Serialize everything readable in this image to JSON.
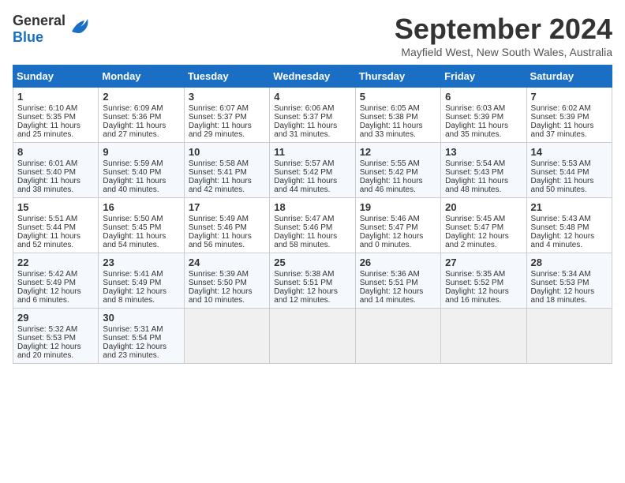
{
  "logo": {
    "general": "General",
    "blue": "Blue"
  },
  "title": "September 2024",
  "subtitle": "Mayfield West, New South Wales, Australia",
  "weekdays": [
    "Sunday",
    "Monday",
    "Tuesday",
    "Wednesday",
    "Thursday",
    "Friday",
    "Saturday"
  ],
  "weeks": [
    [
      {
        "day": "1",
        "sunrise": "6:10 AM",
        "sunset": "5:35 PM",
        "daylight": "11 hours and 25 minutes."
      },
      {
        "day": "2",
        "sunrise": "6:09 AM",
        "sunset": "5:36 PM",
        "daylight": "11 hours and 27 minutes."
      },
      {
        "day": "3",
        "sunrise": "6:07 AM",
        "sunset": "5:37 PM",
        "daylight": "11 hours and 29 minutes."
      },
      {
        "day": "4",
        "sunrise": "6:06 AM",
        "sunset": "5:37 PM",
        "daylight": "11 hours and 31 minutes."
      },
      {
        "day": "5",
        "sunrise": "6:05 AM",
        "sunset": "5:38 PM",
        "daylight": "11 hours and 33 minutes."
      },
      {
        "day": "6",
        "sunrise": "6:03 AM",
        "sunset": "5:39 PM",
        "daylight": "11 hours and 35 minutes."
      },
      {
        "day": "7",
        "sunrise": "6:02 AM",
        "sunset": "5:39 PM",
        "daylight": "11 hours and 37 minutes."
      }
    ],
    [
      {
        "day": "8",
        "sunrise": "6:01 AM",
        "sunset": "5:40 PM",
        "daylight": "11 hours and 38 minutes."
      },
      {
        "day": "9",
        "sunrise": "5:59 AM",
        "sunset": "5:40 PM",
        "daylight": "11 hours and 40 minutes."
      },
      {
        "day": "10",
        "sunrise": "5:58 AM",
        "sunset": "5:41 PM",
        "daylight": "11 hours and 42 minutes."
      },
      {
        "day": "11",
        "sunrise": "5:57 AM",
        "sunset": "5:42 PM",
        "daylight": "11 hours and 44 minutes."
      },
      {
        "day": "12",
        "sunrise": "5:55 AM",
        "sunset": "5:42 PM",
        "daylight": "11 hours and 46 minutes."
      },
      {
        "day": "13",
        "sunrise": "5:54 AM",
        "sunset": "5:43 PM",
        "daylight": "11 hours and 48 minutes."
      },
      {
        "day": "14",
        "sunrise": "5:53 AM",
        "sunset": "5:44 PM",
        "daylight": "11 hours and 50 minutes."
      }
    ],
    [
      {
        "day": "15",
        "sunrise": "5:51 AM",
        "sunset": "5:44 PM",
        "daylight": "11 hours and 52 minutes."
      },
      {
        "day": "16",
        "sunrise": "5:50 AM",
        "sunset": "5:45 PM",
        "daylight": "11 hours and 54 minutes."
      },
      {
        "day": "17",
        "sunrise": "5:49 AM",
        "sunset": "5:46 PM",
        "daylight": "11 hours and 56 minutes."
      },
      {
        "day": "18",
        "sunrise": "5:47 AM",
        "sunset": "5:46 PM",
        "daylight": "11 hours and 58 minutes."
      },
      {
        "day": "19",
        "sunrise": "5:46 AM",
        "sunset": "5:47 PM",
        "daylight": "12 hours and 0 minutes."
      },
      {
        "day": "20",
        "sunrise": "5:45 AM",
        "sunset": "5:47 PM",
        "daylight": "12 hours and 2 minutes."
      },
      {
        "day": "21",
        "sunrise": "5:43 AM",
        "sunset": "5:48 PM",
        "daylight": "12 hours and 4 minutes."
      }
    ],
    [
      {
        "day": "22",
        "sunrise": "5:42 AM",
        "sunset": "5:49 PM",
        "daylight": "12 hours and 6 minutes."
      },
      {
        "day": "23",
        "sunrise": "5:41 AM",
        "sunset": "5:49 PM",
        "daylight": "12 hours and 8 minutes."
      },
      {
        "day": "24",
        "sunrise": "5:39 AM",
        "sunset": "5:50 PM",
        "daylight": "12 hours and 10 minutes."
      },
      {
        "day": "25",
        "sunrise": "5:38 AM",
        "sunset": "5:51 PM",
        "daylight": "12 hours and 12 minutes."
      },
      {
        "day": "26",
        "sunrise": "5:36 AM",
        "sunset": "5:51 PM",
        "daylight": "12 hours and 14 minutes."
      },
      {
        "day": "27",
        "sunrise": "5:35 AM",
        "sunset": "5:52 PM",
        "daylight": "12 hours and 16 minutes."
      },
      {
        "day": "28",
        "sunrise": "5:34 AM",
        "sunset": "5:53 PM",
        "daylight": "12 hours and 18 minutes."
      }
    ],
    [
      {
        "day": "29",
        "sunrise": "5:32 AM",
        "sunset": "5:53 PM",
        "daylight": "12 hours and 20 minutes."
      },
      {
        "day": "30",
        "sunrise": "5:31 AM",
        "sunset": "5:54 PM",
        "daylight": "12 hours and 23 minutes."
      },
      null,
      null,
      null,
      null,
      null
    ]
  ]
}
